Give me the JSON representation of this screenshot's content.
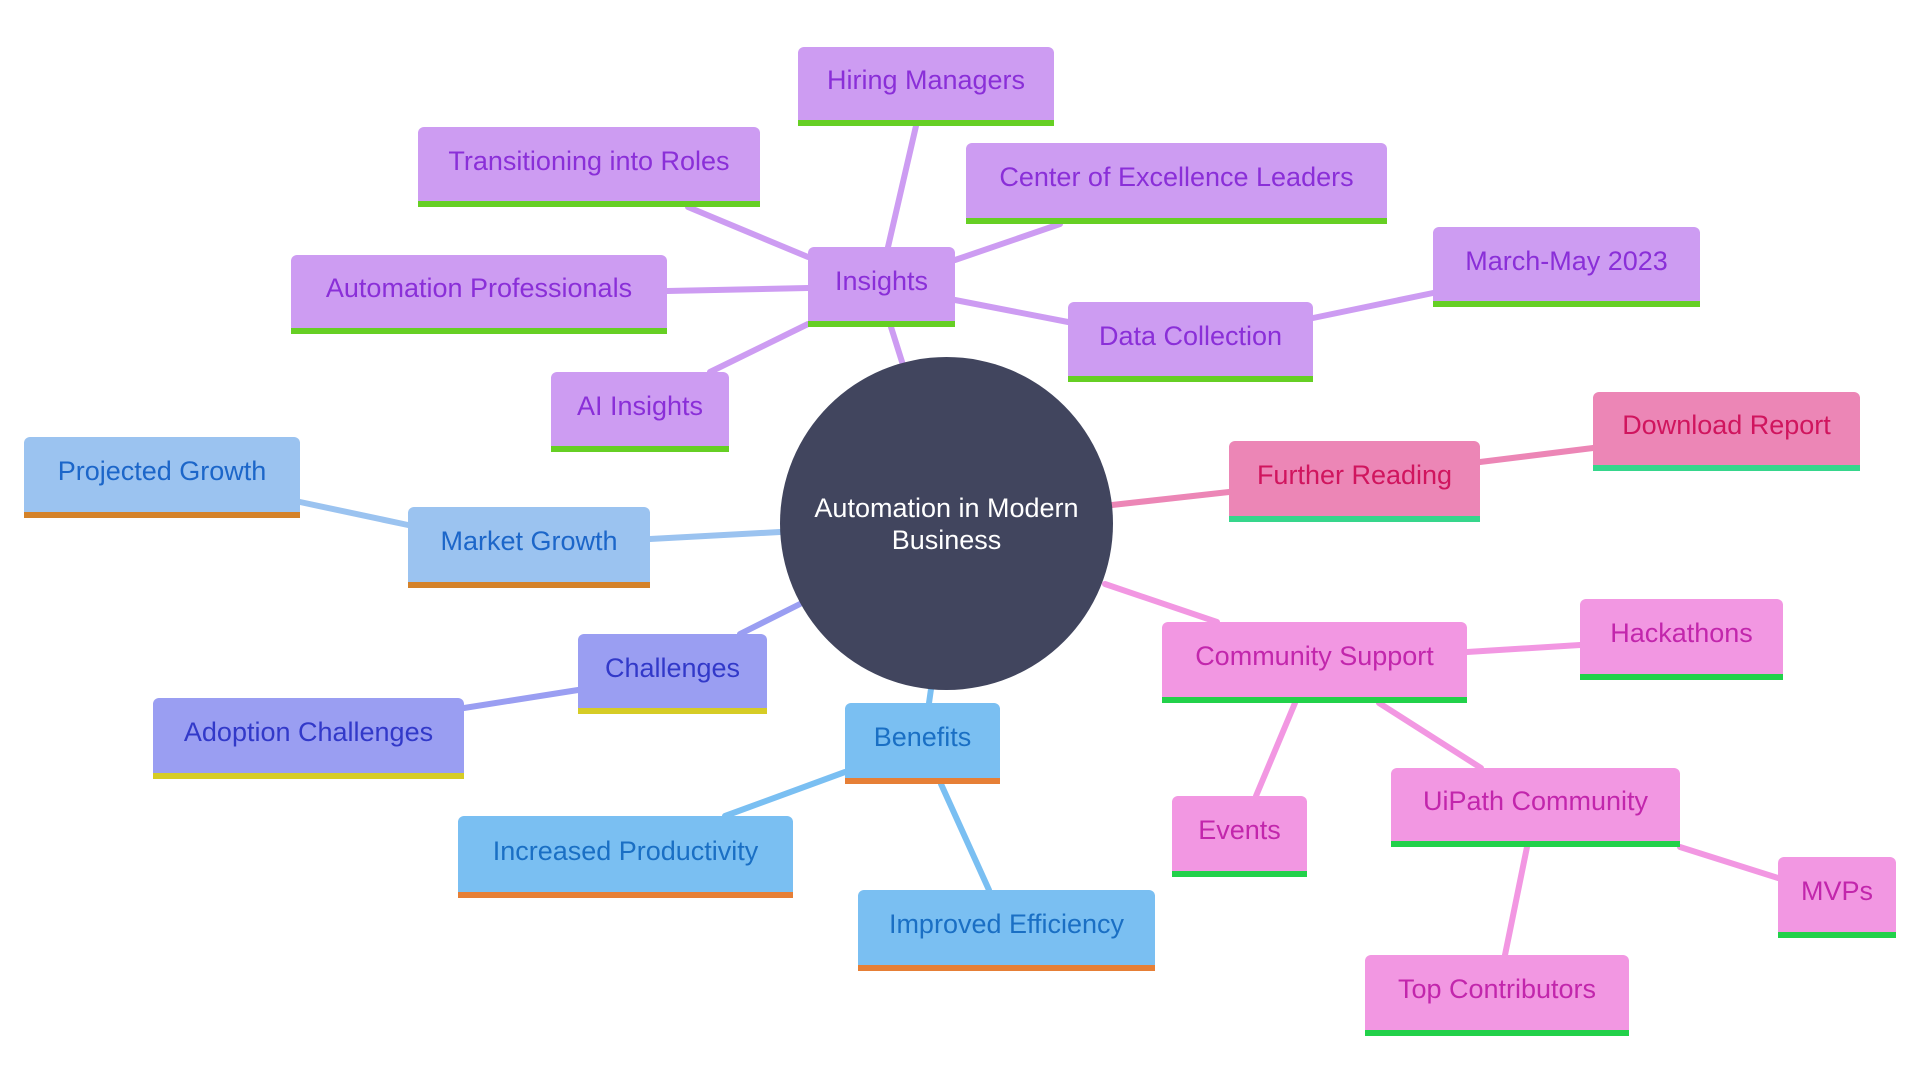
{
  "root": {
    "label_line1": "Automation in Modern",
    "label_line2": "Business",
    "color": "#41455e"
  },
  "branches": {
    "insights": {
      "label": "Insights",
      "color": "#cd9cf2",
      "children": {
        "hiring_managers": "Hiring Managers",
        "transitioning": "Transitioning into Roles",
        "coe_leaders": "Center of Excellence Leaders",
        "automation_professionals": "Automation Professionals",
        "ai_insights": "AI Insights",
        "data_collection": "Data Collection",
        "march_may": "March-May 2023"
      }
    },
    "market_growth": {
      "label": "Market Growth",
      "color": "#9bc3f0",
      "children": {
        "projected_growth": "Projected Growth"
      }
    },
    "challenges": {
      "label": "Challenges",
      "color": "#9a9ef2",
      "children": {
        "adoption_challenges": "Adoption Challenges"
      }
    },
    "benefits": {
      "label": "Benefits",
      "color": "#7abff2",
      "children": {
        "increased_productivity": "Increased Productivity",
        "improved_efficiency": "Improved Efficiency"
      }
    },
    "further_reading": {
      "label": "Further Reading",
      "color": "#ec86b6",
      "children": {
        "download_report": "Download Report"
      }
    },
    "community_support": {
      "label": "Community Support",
      "color": "#f297e2",
      "children": {
        "hackathons": "Hackathons",
        "events": "Events",
        "uipath_community": "UiPath Community",
        "mvps": "MVPs",
        "top_contributors": "Top Contributors"
      }
    }
  }
}
